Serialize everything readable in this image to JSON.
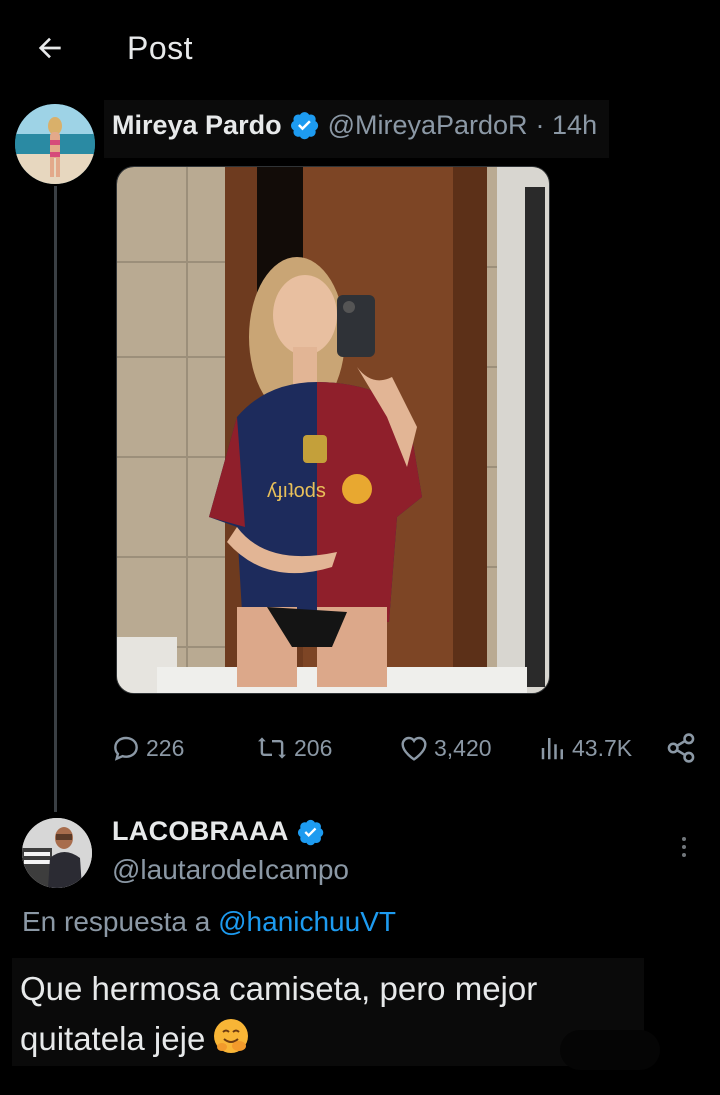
{
  "header": {
    "title": "Post",
    "back_icon": "arrow-left-icon"
  },
  "tweet": {
    "author_name": "Mireya Pardo",
    "author_handle": "@MireyaPardoR",
    "time": "· 14h",
    "verified_color": "#1d9bf0",
    "media_alt": "mirror-selfie-photo",
    "stats": {
      "replies": "226",
      "retweets": "206",
      "likes": "3,420",
      "views": "43.7K"
    },
    "icons": [
      "reply-icon",
      "retweet-icon",
      "like-icon",
      "views-icon",
      "share-icon"
    ]
  },
  "reply": {
    "author_name": "LACOBRAAA",
    "author_handle": "@lautarodeIcampo",
    "reply_prefix": "En respuesta a",
    "reply_mention": "@hanichuuVT",
    "text": "Que hermosa camiseta, pero mejor\nquitatela jeje",
    "emoji": "hugging-face-icon"
  },
  "colors": {
    "background": "#000000",
    "text": "#e7e9ea",
    "muted": "#8b98a5",
    "accent": "#1d9bf0"
  }
}
